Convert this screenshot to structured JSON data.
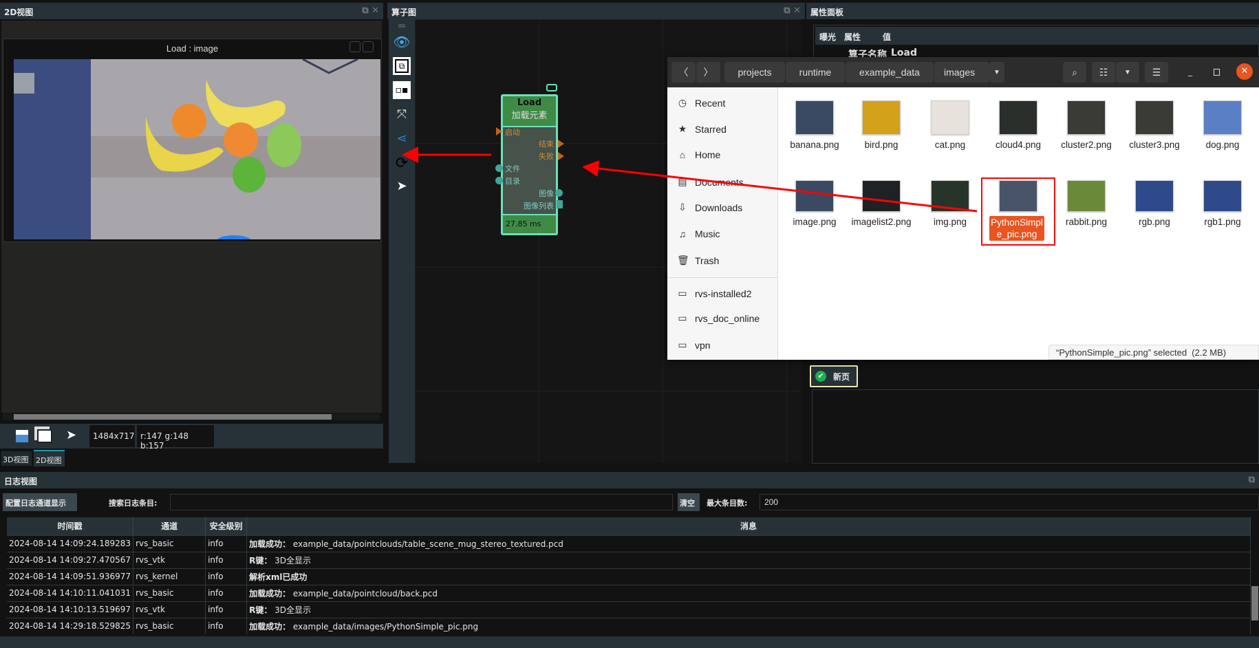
{
  "panels": {
    "view2d": {
      "title": "2D视图",
      "window_title": "Load : image",
      "resolution": "1484x717",
      "pixel": "r:147 g:148 b:157",
      "tabs": [
        "3D视图",
        "2D视图"
      ],
      "active_tab": "2D视图"
    },
    "graph": {
      "title": "算子图",
      "toolbar": [
        "drag-handle-icon",
        "eye-icon",
        "group-icon",
        "ungroup-icon",
        "fit-view-icon",
        "share-nodes-icon",
        "refresh-icon",
        "pointer-icon"
      ],
      "node": {
        "name": "Load",
        "subtitle": "加载元素",
        "inputs": [
          "启动",
          "文件",
          "目录"
        ],
        "outputs": [
          "结束",
          "失败",
          "图像",
          "图像列表"
        ],
        "time": "27.85 ms",
        "color": "#3f8a45",
        "border": "#6ee0b8"
      }
    },
    "properties": {
      "title": "属性面板",
      "columns": [
        "曝光",
        "属性",
        "值"
      ],
      "row": {
        "key": "算子名称",
        "value": "Load"
      },
      "page_tab": "新页"
    }
  },
  "file_dialog": {
    "path": [
      "projects",
      "runtime",
      "example_data",
      "images"
    ],
    "sidebar": [
      {
        "icon": "clock-icon",
        "label": "Recent"
      },
      {
        "icon": "star-icon",
        "label": "Starred"
      },
      {
        "icon": "home-icon",
        "label": "Home"
      },
      {
        "icon": "document-icon",
        "label": "Documents"
      },
      {
        "icon": "download-icon",
        "label": "Downloads"
      },
      {
        "icon": "music-icon",
        "label": "Music"
      },
      {
        "icon": "trash-icon",
        "label": "Trash"
      },
      {
        "icon": "folder-icon",
        "label": "rvs-installed2"
      },
      {
        "icon": "folder-icon",
        "label": "rvs_doc_online"
      },
      {
        "icon": "folder-icon",
        "label": "vpn"
      }
    ],
    "files": [
      {
        "name": "banana.png",
        "color": "#3a4a63"
      },
      {
        "name": "bird.png",
        "color": "#d4a21a"
      },
      {
        "name": "cat.png",
        "color": "#e8e2dc"
      },
      {
        "name": "cloud4.png",
        "color": "#2b2f2b"
      },
      {
        "name": "cluster2.png",
        "color": "#3a3a36"
      },
      {
        "name": "cluster3.png",
        "color": "#3a3a36"
      },
      {
        "name": "dog.png",
        "color": "#5b7fc4"
      },
      {
        "name": "image.png",
        "color": "#3a4a63"
      },
      {
        "name": "imagelist2.png",
        "color": "#1e2224"
      },
      {
        "name": "img.png",
        "color": "#27342a"
      },
      {
        "name": "PythonSimple_pic.png",
        "color": "#4a5468",
        "selected": true
      },
      {
        "name": "rabbit.png",
        "color": "#6a8a3a"
      },
      {
        "name": "rgb.png",
        "color": "#2f4a8a"
      },
      {
        "name": "rgb1.png",
        "color": "#2f4a8a"
      }
    ],
    "status": "“PythonSimple_pic.png” selected  (2.2 MB)",
    "accent": "#e95420"
  },
  "log": {
    "title": "日志视图",
    "config_button": "配置日志通道显示",
    "search_label": "搜索日志条目:",
    "search_value": "",
    "clear_button": "清空",
    "max_label": "最大条目数:",
    "max_value": "200",
    "columns": [
      "时间戳",
      "通道",
      "安全级别",
      "消息"
    ],
    "rows": [
      [
        "2024-08-14 14:09:24.189283",
        "rvs_basic",
        "info",
        "加载成功：",
        " example_data/pointclouds/table_scene_mug_stereo_textured.pcd"
      ],
      [
        "2024-08-14 14:09:27.470567",
        "rvs_vtk",
        "info",
        "R键：",
        " 3D全显示"
      ],
      [
        "2024-08-14 14:09:51.936977",
        "rvs_kernel",
        "info",
        "解析xml已成功",
        ""
      ],
      [
        "2024-08-14 14:10:11.041031",
        "rvs_basic",
        "info",
        "加载成功：",
        " example_data/pointcloud/back.pcd"
      ],
      [
        "2024-08-14 14:10:13.519697",
        "rvs_vtk",
        "info",
        "R键：",
        " 3D全显示"
      ],
      [
        "2024-08-14 14:29:18.529825",
        "rvs_basic",
        "info",
        "加载成功：",
        " example_data/images/PythonSimple_pic.png"
      ]
    ]
  },
  "annotation_color": "#ff0000"
}
